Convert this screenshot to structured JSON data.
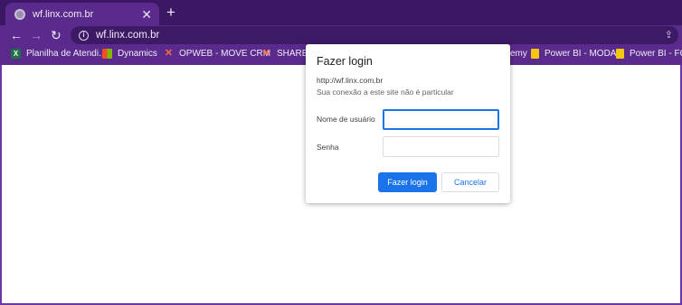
{
  "tab": {
    "title": "wf.linx.com.br",
    "close_glyph": "✕",
    "favicon": "globe-icon"
  },
  "new_tab_glyph": "+",
  "toolbar": {
    "back_glyph": "←",
    "forward_glyph": "→",
    "reload_glyph": "↻",
    "info_glyph": "i",
    "url": "wf.linx.com.br",
    "share_glyph": "⇪"
  },
  "bookmarks": [
    {
      "label": "Planilha de Atendi...",
      "icon": "excel-icon",
      "icon_text": "X"
    },
    {
      "label": "Dynamics",
      "icon": "dynamics-icon",
      "icon_text": ""
    },
    {
      "label": "OPWEB - MOVE CRM",
      "icon": "opweb-icon",
      "icon_text": "✕"
    },
    {
      "label": "SHARE Po",
      "icon": "share-x-icon",
      "icon_text": "✕"
    },
    {
      "label": "emy",
      "icon": "",
      "icon_text": ""
    },
    {
      "label": "Power BI - MODA",
      "icon": "powerbi-icon",
      "icon_text": ""
    },
    {
      "label": "Power BI - FOO",
      "icon": "powerbi-icon",
      "icon_text": ""
    }
  ],
  "dialog": {
    "title": "Fazer login",
    "url": "http://wf.linx.com.br",
    "note": "Sua conexão a este site não é particular",
    "username_label": "Nome de usuário",
    "password_label": "Senha",
    "username_value": "",
    "password_value": "",
    "login_button": "Fazer login",
    "cancel_button": "Cancelar"
  },
  "colors": {
    "browser_frame": "#5a2b8c",
    "accent": "#1a73e8"
  }
}
